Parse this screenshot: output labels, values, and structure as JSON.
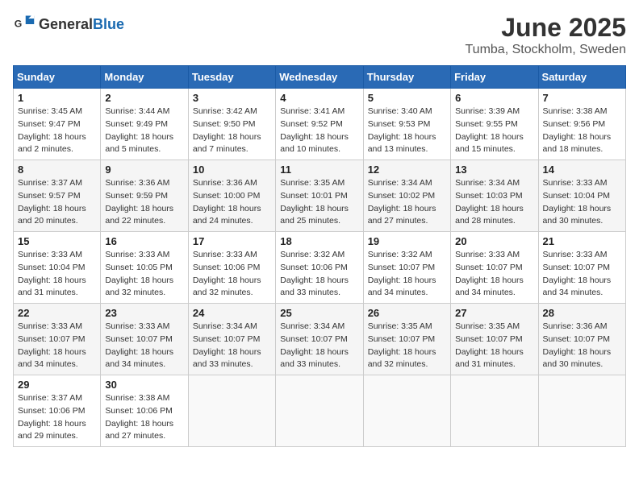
{
  "logo": {
    "general": "General",
    "blue": "Blue"
  },
  "title": "June 2025",
  "location": "Tumba, Stockholm, Sweden",
  "headers": [
    "Sunday",
    "Monday",
    "Tuesday",
    "Wednesday",
    "Thursday",
    "Friday",
    "Saturday"
  ],
  "weeks": [
    [
      {
        "day": "1",
        "sunrise": "3:45 AM",
        "sunset": "9:47 PM",
        "daylight": "18 hours and 2 minutes."
      },
      {
        "day": "2",
        "sunrise": "3:44 AM",
        "sunset": "9:49 PM",
        "daylight": "18 hours and 5 minutes."
      },
      {
        "day": "3",
        "sunrise": "3:42 AM",
        "sunset": "9:50 PM",
        "daylight": "18 hours and 7 minutes."
      },
      {
        "day": "4",
        "sunrise": "3:41 AM",
        "sunset": "9:52 PM",
        "daylight": "18 hours and 10 minutes."
      },
      {
        "day": "5",
        "sunrise": "3:40 AM",
        "sunset": "9:53 PM",
        "daylight": "18 hours and 13 minutes."
      },
      {
        "day": "6",
        "sunrise": "3:39 AM",
        "sunset": "9:55 PM",
        "daylight": "18 hours and 15 minutes."
      },
      {
        "day": "7",
        "sunrise": "3:38 AM",
        "sunset": "9:56 PM",
        "daylight": "18 hours and 18 minutes."
      }
    ],
    [
      {
        "day": "8",
        "sunrise": "3:37 AM",
        "sunset": "9:57 PM",
        "daylight": "18 hours and 20 minutes."
      },
      {
        "day": "9",
        "sunrise": "3:36 AM",
        "sunset": "9:59 PM",
        "daylight": "18 hours and 22 minutes."
      },
      {
        "day": "10",
        "sunrise": "3:36 AM",
        "sunset": "10:00 PM",
        "daylight": "18 hours and 24 minutes."
      },
      {
        "day": "11",
        "sunrise": "3:35 AM",
        "sunset": "10:01 PM",
        "daylight": "18 hours and 25 minutes."
      },
      {
        "day": "12",
        "sunrise": "3:34 AM",
        "sunset": "10:02 PM",
        "daylight": "18 hours and 27 minutes."
      },
      {
        "day": "13",
        "sunrise": "3:34 AM",
        "sunset": "10:03 PM",
        "daylight": "18 hours and 28 minutes."
      },
      {
        "day": "14",
        "sunrise": "3:33 AM",
        "sunset": "10:04 PM",
        "daylight": "18 hours and 30 minutes."
      }
    ],
    [
      {
        "day": "15",
        "sunrise": "3:33 AM",
        "sunset": "10:04 PM",
        "daylight": "18 hours and 31 minutes."
      },
      {
        "day": "16",
        "sunrise": "3:33 AM",
        "sunset": "10:05 PM",
        "daylight": "18 hours and 32 minutes."
      },
      {
        "day": "17",
        "sunrise": "3:33 AM",
        "sunset": "10:06 PM",
        "daylight": "18 hours and 32 minutes."
      },
      {
        "day": "18",
        "sunrise": "3:32 AM",
        "sunset": "10:06 PM",
        "daylight": "18 hours and 33 minutes."
      },
      {
        "day": "19",
        "sunrise": "3:32 AM",
        "sunset": "10:07 PM",
        "daylight": "18 hours and 34 minutes."
      },
      {
        "day": "20",
        "sunrise": "3:33 AM",
        "sunset": "10:07 PM",
        "daylight": "18 hours and 34 minutes."
      },
      {
        "day": "21",
        "sunrise": "3:33 AM",
        "sunset": "10:07 PM",
        "daylight": "18 hours and 34 minutes."
      }
    ],
    [
      {
        "day": "22",
        "sunrise": "3:33 AM",
        "sunset": "10:07 PM",
        "daylight": "18 hours and 34 minutes."
      },
      {
        "day": "23",
        "sunrise": "3:33 AM",
        "sunset": "10:07 PM",
        "daylight": "18 hours and 34 minutes."
      },
      {
        "day": "24",
        "sunrise": "3:34 AM",
        "sunset": "10:07 PM",
        "daylight": "18 hours and 33 minutes."
      },
      {
        "day": "25",
        "sunrise": "3:34 AM",
        "sunset": "10:07 PM",
        "daylight": "18 hours and 33 minutes."
      },
      {
        "day": "26",
        "sunrise": "3:35 AM",
        "sunset": "10:07 PM",
        "daylight": "18 hours and 32 minutes."
      },
      {
        "day": "27",
        "sunrise": "3:35 AM",
        "sunset": "10:07 PM",
        "daylight": "18 hours and 31 minutes."
      },
      {
        "day": "28",
        "sunrise": "3:36 AM",
        "sunset": "10:07 PM",
        "daylight": "18 hours and 30 minutes."
      }
    ],
    [
      {
        "day": "29",
        "sunrise": "3:37 AM",
        "sunset": "10:06 PM",
        "daylight": "18 hours and 29 minutes."
      },
      {
        "day": "30",
        "sunrise": "3:38 AM",
        "sunset": "10:06 PM",
        "daylight": "18 hours and 27 minutes."
      },
      null,
      null,
      null,
      null,
      null
    ]
  ],
  "labels": {
    "sunrise": "Sunrise:",
    "sunset": "Sunset:",
    "daylight": "Daylight:"
  }
}
